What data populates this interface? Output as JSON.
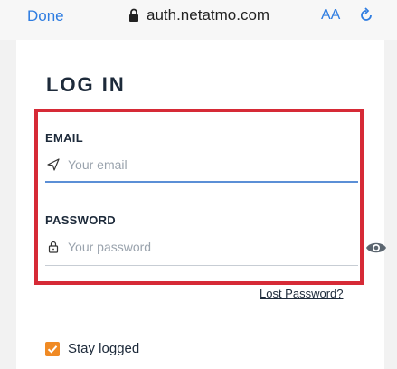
{
  "browser": {
    "done_label": "Done",
    "url": "auth.netatmo.com",
    "text_size_label": "AA",
    "icons": [
      "lock-icon",
      "reload-icon"
    ]
  },
  "form": {
    "title": "LOG IN",
    "email": {
      "label": "EMAIL",
      "placeholder": "Your email",
      "value": "",
      "icon": "paper-plane-icon"
    },
    "password": {
      "label": "PASSWORD",
      "placeholder": "Your password",
      "value": "",
      "icon": "lock-icon",
      "reveal_icon": "eye-icon"
    },
    "lost_password_label": "Lost Password?",
    "stay_logged": {
      "label": "Stay logged",
      "checked": true
    }
  },
  "colors": {
    "accent": "#2f7de1",
    "highlight": "#d62a36",
    "checkbox": "#f08a24",
    "focus_line": "#5b8fd6"
  }
}
